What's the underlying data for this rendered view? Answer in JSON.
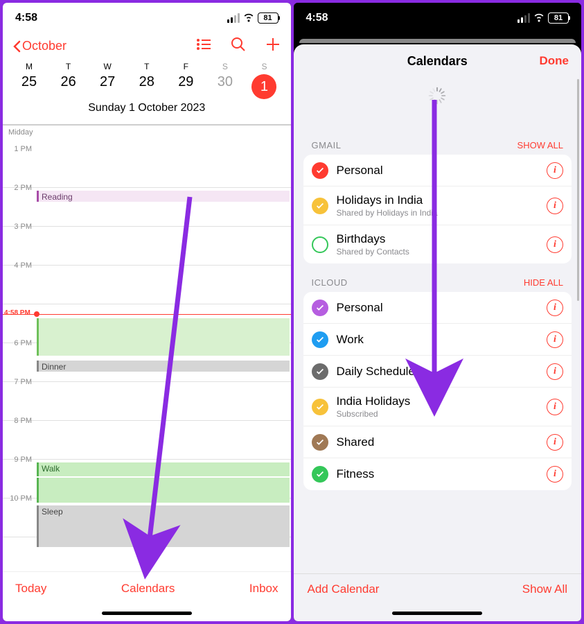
{
  "status": {
    "time": "4:58",
    "battery": "81"
  },
  "left": {
    "back": "October",
    "weekdays": [
      "M",
      "T",
      "W",
      "T",
      "F",
      "S",
      "S"
    ],
    "dates": [
      "25",
      "26",
      "27",
      "28",
      "29",
      "30",
      "1"
    ],
    "full_date": "Sunday  1 October 2023",
    "midday": "Midday",
    "hours": [
      "1 PM",
      "2 PM",
      "3 PM",
      "4 PM",
      "",
      "6 PM",
      "7 PM",
      "8 PM",
      "9 PM",
      "10 PM"
    ],
    "now": "4:58 PM",
    "events": {
      "reading": "Reading",
      "dinner": "Dinner",
      "walk": "Walk",
      "sleep": "Sleep"
    },
    "bottom": {
      "today": "Today",
      "calendars": "Calendars",
      "inbox": "Inbox"
    }
  },
  "right": {
    "title": "Calendars",
    "done": "Done",
    "sections": [
      {
        "name": "GMAIL",
        "action": "SHOW ALL",
        "items": [
          {
            "color": "#ff3b30",
            "checked": true,
            "name": "Personal",
            "sub": ""
          },
          {
            "color": "#f7c23a",
            "checked": true,
            "name": "Holidays in India",
            "sub": "Shared by Holidays in India"
          },
          {
            "color": "#34c759",
            "checked": false,
            "outline": true,
            "name": "Birthdays",
            "sub": "Shared by Contacts"
          }
        ]
      },
      {
        "name": "ICLOUD",
        "action": "HIDE ALL",
        "items": [
          {
            "color": "#b65ee0",
            "checked": true,
            "name": "Personal",
            "sub": ""
          },
          {
            "color": "#1f9df1",
            "checked": true,
            "name": "Work",
            "sub": ""
          },
          {
            "color": "#6c6c6c",
            "checked": true,
            "name": "Daily Schedule",
            "sub": ""
          },
          {
            "color": "#f7c23a",
            "checked": true,
            "name": "India Holidays",
            "sub": "Subscribed"
          },
          {
            "color": "#a07955",
            "checked": true,
            "name": "Shared",
            "sub": ""
          },
          {
            "color": "#34c759",
            "checked": true,
            "name": "Fitness",
            "sub": ""
          }
        ]
      }
    ],
    "bottom": {
      "add": "Add Calendar",
      "showall": "Show All"
    }
  }
}
